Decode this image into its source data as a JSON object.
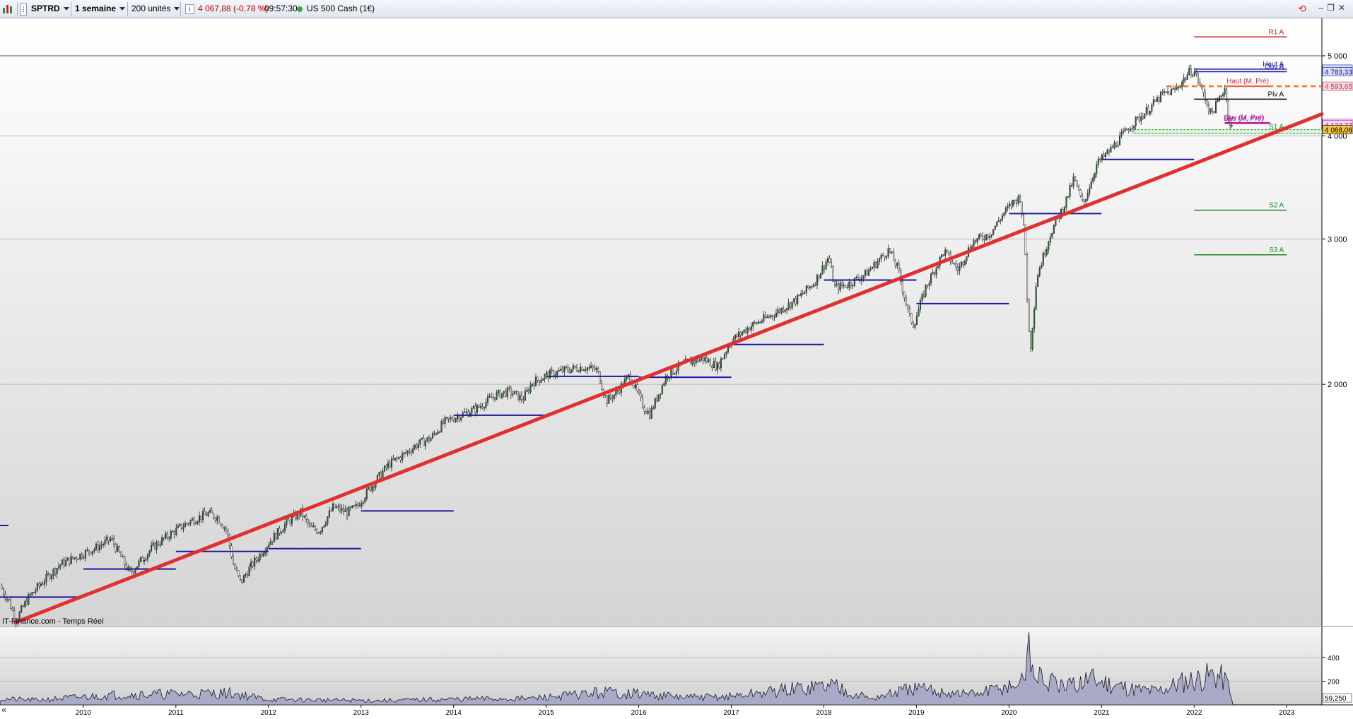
{
  "toolbar": {
    "symbol": "SPTRD",
    "period": "1 semaine",
    "units": "200 unités",
    "info_icon": "i",
    "price_change": "4 067,88 (-0,78 %)",
    "time": "09:57:30",
    "market": "US 500 Cash (1€)",
    "colors": {
      "negative": "#c00000",
      "status_dot": "#2fae3b"
    },
    "icons": [
      "chart-logo-icon",
      "mode-icon",
      "info-icon",
      "refresh-icon",
      "minimize-icon",
      "restore-icon",
      "close-icon"
    ]
  },
  "chart_data": {
    "type": "candlestick",
    "instrument": "US 500 Cash (1€)",
    "source_label": "IT-Finance.com - Temps Réel",
    "scale": "log",
    "x_ticks": [
      "2010",
      "2011",
      "2012",
      "2013",
      "2014",
      "2015",
      "2016",
      "2017",
      "2018",
      "2019",
      "2020",
      "2021",
      "2022",
      "2023"
    ],
    "price_ticks": [
      "5 000",
      "4 000",
      "3 000",
      "2 000"
    ],
    "price_tick_values": [
      5000,
      4000,
      3000,
      2000
    ],
    "ylim": [
      1020,
      5550
    ],
    "xlim": [
      2009.1,
      2023.38
    ],
    "price_path": [
      [
        2009.1,
        1140
      ],
      [
        2009.2,
        1090
      ],
      [
        2009.27,
        1035
      ],
      [
        2009.4,
        1100
      ],
      [
        2009.55,
        1150
      ],
      [
        2009.75,
        1210
      ],
      [
        2009.95,
        1240
      ],
      [
        2010.15,
        1270
      ],
      [
        2010.3,
        1300
      ],
      [
        2010.4,
        1240
      ],
      [
        2010.5,
        1180
      ],
      [
        2010.6,
        1215
      ],
      [
        2010.75,
        1270
      ],
      [
        2010.95,
        1320
      ],
      [
        2011.15,
        1365
      ],
      [
        2011.35,
        1395
      ],
      [
        2011.45,
        1380
      ],
      [
        2011.55,
        1330
      ],
      [
        2011.62,
        1210
      ],
      [
        2011.7,
        1150
      ],
      [
        2011.8,
        1200
      ],
      [
        2011.9,
        1240
      ],
      [
        2012.0,
        1285
      ],
      [
        2012.2,
        1360
      ],
      [
        2012.35,
        1400
      ],
      [
        2012.45,
        1340
      ],
      [
        2012.55,
        1330
      ],
      [
        2012.7,
        1420
      ],
      [
        2012.85,
        1400
      ],
      [
        2012.95,
        1420
      ],
      [
        2013.1,
        1500
      ],
      [
        2013.3,
        1600
      ],
      [
        2013.45,
        1640
      ],
      [
        2013.6,
        1690
      ],
      [
        2013.75,
        1720
      ],
      [
        2013.9,
        1800
      ],
      [
        2014.05,
        1830
      ],
      [
        2014.25,
        1870
      ],
      [
        2014.45,
        1940
      ],
      [
        2014.6,
        1960
      ],
      [
        2014.75,
        1920
      ],
      [
        2014.85,
        2010
      ],
      [
        2015.0,
        2050
      ],
      [
        2015.2,
        2080
      ],
      [
        2015.4,
        2100
      ],
      [
        2015.55,
        2080
      ],
      [
        2015.65,
        1910
      ],
      [
        2015.75,
        1950
      ],
      [
        2015.9,
        2050
      ],
      [
        2016.05,
        1880
      ],
      [
        2016.12,
        1840
      ],
      [
        2016.3,
        2050
      ],
      [
        2016.5,
        2120
      ],
      [
        2016.7,
        2150
      ],
      [
        2016.85,
        2100
      ],
      [
        2017.0,
        2260
      ],
      [
        2017.2,
        2350
      ],
      [
        2017.45,
        2430
      ],
      [
        2017.7,
        2530
      ],
      [
        2017.9,
        2660
      ],
      [
        2018.05,
        2850
      ],
      [
        2018.12,
        2620
      ],
      [
        2018.25,
        2640
      ],
      [
        2018.45,
        2720
      ],
      [
        2018.7,
        2910
      ],
      [
        2018.8,
        2760
      ],
      [
        2018.92,
        2420
      ],
      [
        2018.97,
        2360
      ],
      [
        2019.1,
        2620
      ],
      [
        2019.3,
        2900
      ],
      [
        2019.45,
        2750
      ],
      [
        2019.6,
        2970
      ],
      [
        2019.8,
        3050
      ],
      [
        2019.95,
        3230
      ],
      [
        2020.05,
        3330
      ],
      [
        2020.12,
        3370
      ],
      [
        2020.17,
        3000
      ],
      [
        2020.21,
        2350
      ],
      [
        2020.23,
        2200
      ],
      [
        2020.3,
        2700
      ],
      [
        2020.45,
        3050
      ],
      [
        2020.6,
        3300
      ],
      [
        2020.7,
        3550
      ],
      [
        2020.8,
        3300
      ],
      [
        2020.95,
        3700
      ],
      [
        2021.1,
        3850
      ],
      [
        2021.3,
        4100
      ],
      [
        2021.5,
        4300
      ],
      [
        2021.65,
        4480
      ],
      [
        2021.8,
        4550
      ],
      [
        2021.95,
        4780
      ],
      [
        2022.0,
        4790
      ],
      [
        2022.1,
        4500
      ],
      [
        2022.18,
        4250
      ],
      [
        2022.25,
        4380
      ],
      [
        2022.33,
        4580
      ],
      [
        2022.38,
        4150
      ],
      [
        2022.4,
        4120
      ],
      [
        2022.42,
        4068
      ]
    ],
    "trendline": {
      "points": [
        [
          2009.27,
          1030
        ],
        [
          2023.38,
          4250
        ]
      ],
      "color": "#e03030"
    },
    "blue_levels": [
      [
        2009.1,
        2010.0,
        1105
      ],
      [
        2010.0,
        2011.0,
        1195
      ],
      [
        2011.0,
        2012.0,
        1255
      ],
      [
        2012.0,
        2013.0,
        1265
      ],
      [
        2013.0,
        2014.0,
        1405
      ],
      [
        2014.0,
        2015.0,
        1835
      ],
      [
        2015.0,
        2016.0,
        2045
      ],
      [
        2016.0,
        2017.0,
        2040
      ],
      [
        2017.0,
        2018.0,
        2235
      ],
      [
        2018.0,
        2019.0,
        2675
      ],
      [
        2019.0,
        2020.0,
        2505
      ],
      [
        2020.0,
        2021.0,
        3220
      ],
      [
        2021.0,
        2022.0,
        3745
      ]
    ],
    "pivot_levels": [
      {
        "label": "R1 A",
        "value": 5270,
        "color": "#cc2020"
      },
      {
        "label": "Haut A",
        "value": 4817,
        "color": "#1a1aa0"
      },
      {
        "label": "Ouv A",
        "value": 4783,
        "color": "#1a1aa0"
      },
      {
        "label": "Piv A",
        "value": 4430,
        "color": "#000000"
      },
      {
        "label": "S1 A",
        "value": 4045,
        "color": "#1f8a1f"
      },
      {
        "label": "S2 A",
        "value": 3250,
        "color": "#1f8a1f"
      },
      {
        "label": "S3 A",
        "value": 2870,
        "color": "#1f8a1f"
      }
    ],
    "monthly_levels": [
      {
        "label": "Haut (M, Pré)",
        "value": 4593,
        "color": "#d03050"
      },
      {
        "label": "Ouv (M, Pré)",
        "value": 4150,
        "color": "#b01a9a"
      },
      {
        "label": "Bas (M, Pré)",
        "value": 4140,
        "color": "#b01a9a"
      }
    ],
    "dashed_level": {
      "value": 4593,
      "color": "#f07820"
    },
    "price_labels": [
      {
        "text": "4 817,53",
        "value": 4817,
        "color": "#1a1aa0",
        "bg": "#d8dcf4"
      },
      {
        "text": "4 783,33",
        "value": 4783,
        "color": "#1a1aa0",
        "bg": "#d8dcf4"
      },
      {
        "text": "4 593,65",
        "value": 4593,
        "color": "#d03050",
        "bg": "#f6dce2"
      },
      {
        "text": "4 140,06",
        "value": 4142,
        "color": "#b01a9a",
        "bg": "#f4dcef"
      },
      {
        "text": "4 123,77",
        "value": 4124,
        "color": "#b01a9a",
        "bg": "#f4dcef"
      },
      {
        "text": "4 068,06",
        "value": 4068,
        "color": "#000000",
        "bg": "#f5c542"
      }
    ],
    "volume": {
      "ticks": [
        "400",
        "200"
      ],
      "tick_values": [
        400,
        200
      ],
      "ylim": [
        0,
        550
      ],
      "current_label": "59,250",
      "spikes": [
        [
          2009.1,
          55
        ],
        [
          2009.5,
          45
        ],
        [
          2010.35,
          95
        ],
        [
          2011.6,
          110
        ],
        [
          2012.0,
          50
        ],
        [
          2013.2,
          40
        ],
        [
          2014.1,
          55
        ],
        [
          2014.85,
          60
        ],
        [
          2015.65,
          120
        ],
        [
          2016.05,
          100
        ],
        [
          2016.5,
          70
        ],
        [
          2016.95,
          75
        ],
        [
          2018.1,
          190
        ],
        [
          2018.5,
          55
        ],
        [
          2018.95,
          150
        ],
        [
          2019.4,
          110
        ],
        [
          2019.65,
          100
        ],
        [
          2020.15,
          210
        ],
        [
          2020.2,
          530
        ],
        [
          2020.3,
          260
        ],
        [
          2020.6,
          150
        ],
        [
          2020.85,
          250
        ],
        [
          2021.1,
          200
        ],
        [
          2021.35,
          150
        ],
        [
          2021.6,
          130
        ],
        [
          2021.9,
          230
        ],
        [
          2022.05,
          250
        ],
        [
          2022.2,
          290
        ],
        [
          2022.3,
          260
        ],
        [
          2022.4,
          170
        ]
      ]
    }
  }
}
